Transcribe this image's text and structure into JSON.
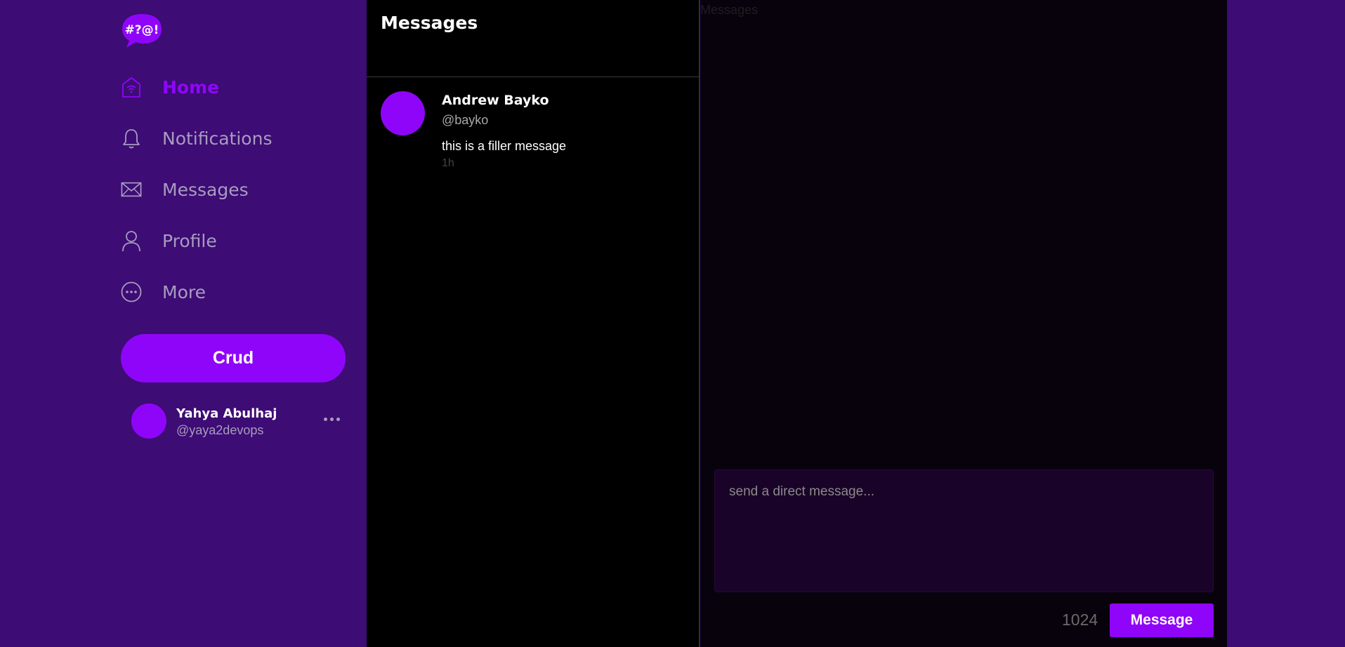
{
  "colors": {
    "accent": "#8f05fa",
    "background": "#3d0c74",
    "panel": "#000000",
    "muted_text": "#a89cc0"
  },
  "logo": {
    "text": "#?@!"
  },
  "nav": {
    "items": [
      {
        "label": "Home",
        "icon": "home-icon"
      },
      {
        "label": "Notifications",
        "icon": "bell-icon"
      },
      {
        "label": "Messages",
        "icon": "envelope-icon"
      },
      {
        "label": "Profile",
        "icon": "user-icon"
      },
      {
        "label": "More",
        "icon": "more-circle-icon"
      }
    ],
    "active": "Home"
  },
  "crud_button": {
    "label": "Crud"
  },
  "current_user": {
    "name": "Yahya Abulhaj",
    "handle": "@yaya2devops"
  },
  "messages_list": {
    "title": "Messages",
    "items": [
      {
        "name": "Andrew Bayko",
        "handle": "@bayko",
        "text": "this is a filler message",
        "time": "1h"
      }
    ]
  },
  "conversation": {
    "title": "Messages",
    "input_placeholder": "send a direct message...",
    "char_count": "1024",
    "send_label": "Message"
  }
}
